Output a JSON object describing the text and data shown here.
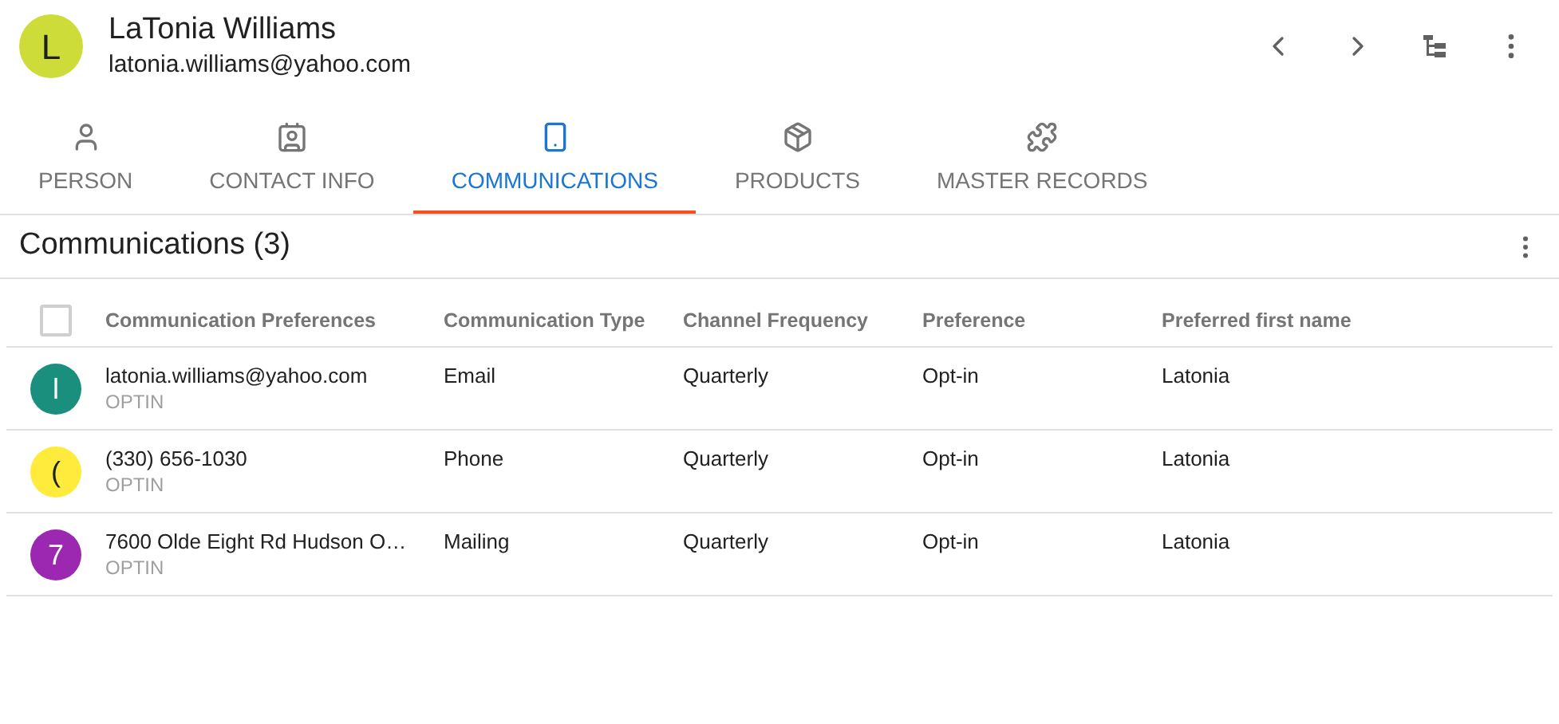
{
  "person": {
    "initial": "L",
    "name": "LaTonia Williams",
    "email": "latonia.williams@yahoo.com"
  },
  "tabs": [
    {
      "label": "PERSON",
      "kind": "person",
      "selected": false
    },
    {
      "label": "CONTACT INFO",
      "kind": "contact",
      "selected": false
    },
    {
      "label": "COMMUNICATIONS",
      "kind": "phone",
      "selected": true
    },
    {
      "label": "PRODUCTS",
      "kind": "box",
      "selected": false
    },
    {
      "label": "MASTER RECORDS",
      "kind": "puzzle",
      "selected": false
    }
  ],
  "section": {
    "title": "Communications (3)"
  },
  "table": {
    "select_all": {
      "checked": false
    },
    "columns": [
      "Communication Preferences",
      "Communication Type",
      "Channel Frequency",
      "Preference",
      "Preferred first name"
    ],
    "rows": [
      {
        "initial": "l",
        "color": "#1a8f7e",
        "value": "latonia.williams@yahoo.com",
        "status": "OPTIN",
        "type": "Email",
        "frequency": "Quarterly",
        "preference": "Opt-in",
        "first_name": "Latonia"
      },
      {
        "initial": "(",
        "color": "#ffeb3b",
        "value": "(330) 656-1030",
        "status": "OPTIN",
        "type": "Phone",
        "frequency": "Quarterly",
        "preference": "Opt-in",
        "first_name": "Latonia"
      },
      {
        "initial": "7",
        "color": "#9c27b0",
        "value": "7600 Olde Eight Rd Hudson O…",
        "status": "OPTIN",
        "type": "Mailing",
        "frequency": "Quarterly",
        "preference": "Opt-in",
        "first_name": "Latonia"
      }
    ]
  }
}
